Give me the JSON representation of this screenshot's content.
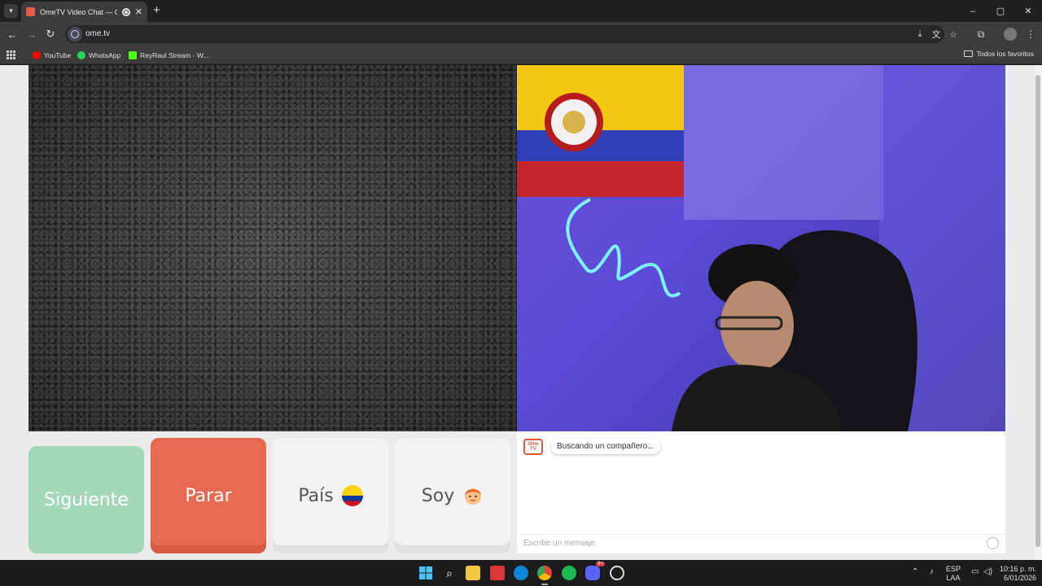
{
  "browser": {
    "tab_title": "OmeTV Video Chat — Ome",
    "tab_close": "✕",
    "new_tab": "+",
    "url": "ome.tv",
    "window_controls": {
      "minimize": "–",
      "maximize": "▢",
      "close": "✕"
    }
  },
  "bookmarks": {
    "items": [
      {
        "label": "YouTube",
        "color": "#ff0000"
      },
      {
        "label": "WhatsApp",
        "color": "#25d366"
      },
      {
        "label": "ReyRaul Stream - W...",
        "color": "#53fc18"
      }
    ],
    "all_label": "Todos los favoritos"
  },
  "controls": {
    "next_label": "Siguiente",
    "stop_label": "Parar",
    "country_label": "País",
    "gender_label": "Soy"
  },
  "chat": {
    "logo_text": "Ome TV",
    "status_message": "Buscando un compañero...",
    "input_placeholder": "Escribe un mensaje"
  },
  "taskbar": {
    "lang_top": "ESP",
    "lang_bottom": "LAA",
    "time": "10:16 p. m.",
    "date": "6/01/2026",
    "discord_badge": "9+"
  },
  "colors": {
    "next_button": "#a3d9b9",
    "stop_button": "#e66a52",
    "accent": "#e0553f"
  }
}
